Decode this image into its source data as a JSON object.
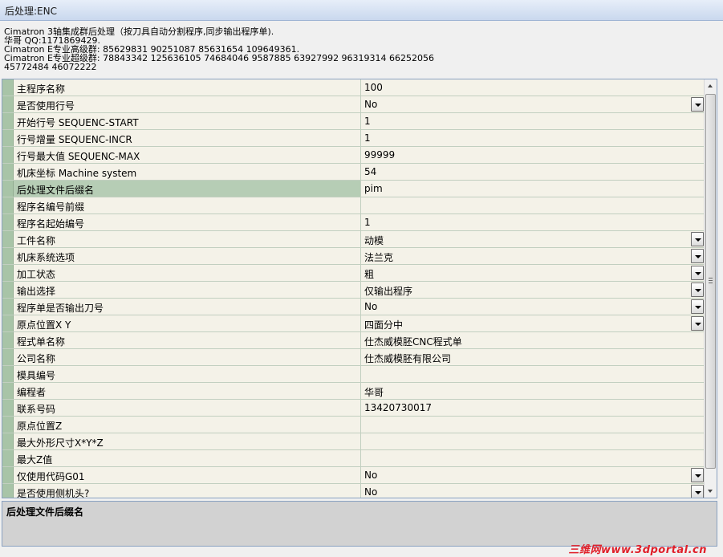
{
  "window": {
    "title": "后处理:ENC"
  },
  "info_lines": [
    "Cimatron 3轴集成群后处理（按刀具自动分割程序,同步输出程序单).",
    "华哥 QQ:1171869429.",
    "Cimatron E专业高级群: 85629831  90251087  85631654 109649361.",
    "Cimatron E专业超级群: 78843342  125636105 74684046 9587885 63927992 96319314 66252056",
    "45772484  46072222"
  ],
  "properties": [
    {
      "name": "主程序名称",
      "value": "100",
      "dropdown": false
    },
    {
      "name": "是否使用行号",
      "value": "No",
      "dropdown": true
    },
    {
      "name": "开始行号 SEQUENC-START",
      "value": "1",
      "dropdown": false
    },
    {
      "name": "行号增量 SEQUENC-INCR",
      "value": "1",
      "dropdown": false
    },
    {
      "name": "行号最大值 SEQUENC-MAX",
      "value": "99999",
      "dropdown": false
    },
    {
      "name": "机床坐标 Machine system",
      "value": "54",
      "dropdown": false
    },
    {
      "name": "后处理文件后缀名",
      "value": "pim",
      "dropdown": false,
      "selected": true
    },
    {
      "name": "程序名编号前缀",
      "value": "",
      "dropdown": false
    },
    {
      "name": "程序名起始编号",
      "value": "1",
      "dropdown": false
    },
    {
      "name": "工件名称",
      "value": "动模",
      "dropdown": true
    },
    {
      "name": "机床系统选项",
      "value": "法兰克",
      "dropdown": true
    },
    {
      "name": "加工状态",
      "value": "粗",
      "dropdown": true
    },
    {
      "name": "输出选择",
      "value": "仅输出程序",
      "dropdown": true
    },
    {
      "name": "程序单是否输出刀号",
      "value": "No",
      "dropdown": true
    },
    {
      "name": "原点位置X Y",
      "value": "四面分中",
      "dropdown": true
    },
    {
      "name": "程式单名称",
      "value": "仕杰威模胚CNC程式单",
      "dropdown": false
    },
    {
      "name": "公司名称",
      "value": "仕杰威模胚有限公司",
      "dropdown": false
    },
    {
      "name": "模具编号",
      "value": "",
      "dropdown": false
    },
    {
      "name": "编程者",
      "value": "华哥",
      "dropdown": false
    },
    {
      "name": "联系号码",
      "value": "13420730017",
      "dropdown": false
    },
    {
      "name": "原点位置Z",
      "value": "",
      "dropdown": false
    },
    {
      "name": "最大外形尺寸X*Y*Z",
      "value": "",
      "dropdown": false
    },
    {
      "name": "最大Z值",
      "value": "",
      "dropdown": false
    },
    {
      "name": "仅使用代码G01",
      "value": "No",
      "dropdown": true
    },
    {
      "name": "是否使用侧机头?",
      "value": "No",
      "dropdown": true
    }
  ],
  "description": {
    "title": "后处理文件后缀名"
  },
  "watermark": {
    "text": "三维网www.3dportal.cn"
  },
  "colors": {
    "gutter": "#a8c4a7",
    "selected_row": "#b6cdb5",
    "row_bg": "#f4f2e8",
    "watermark": "#e0202a"
  }
}
